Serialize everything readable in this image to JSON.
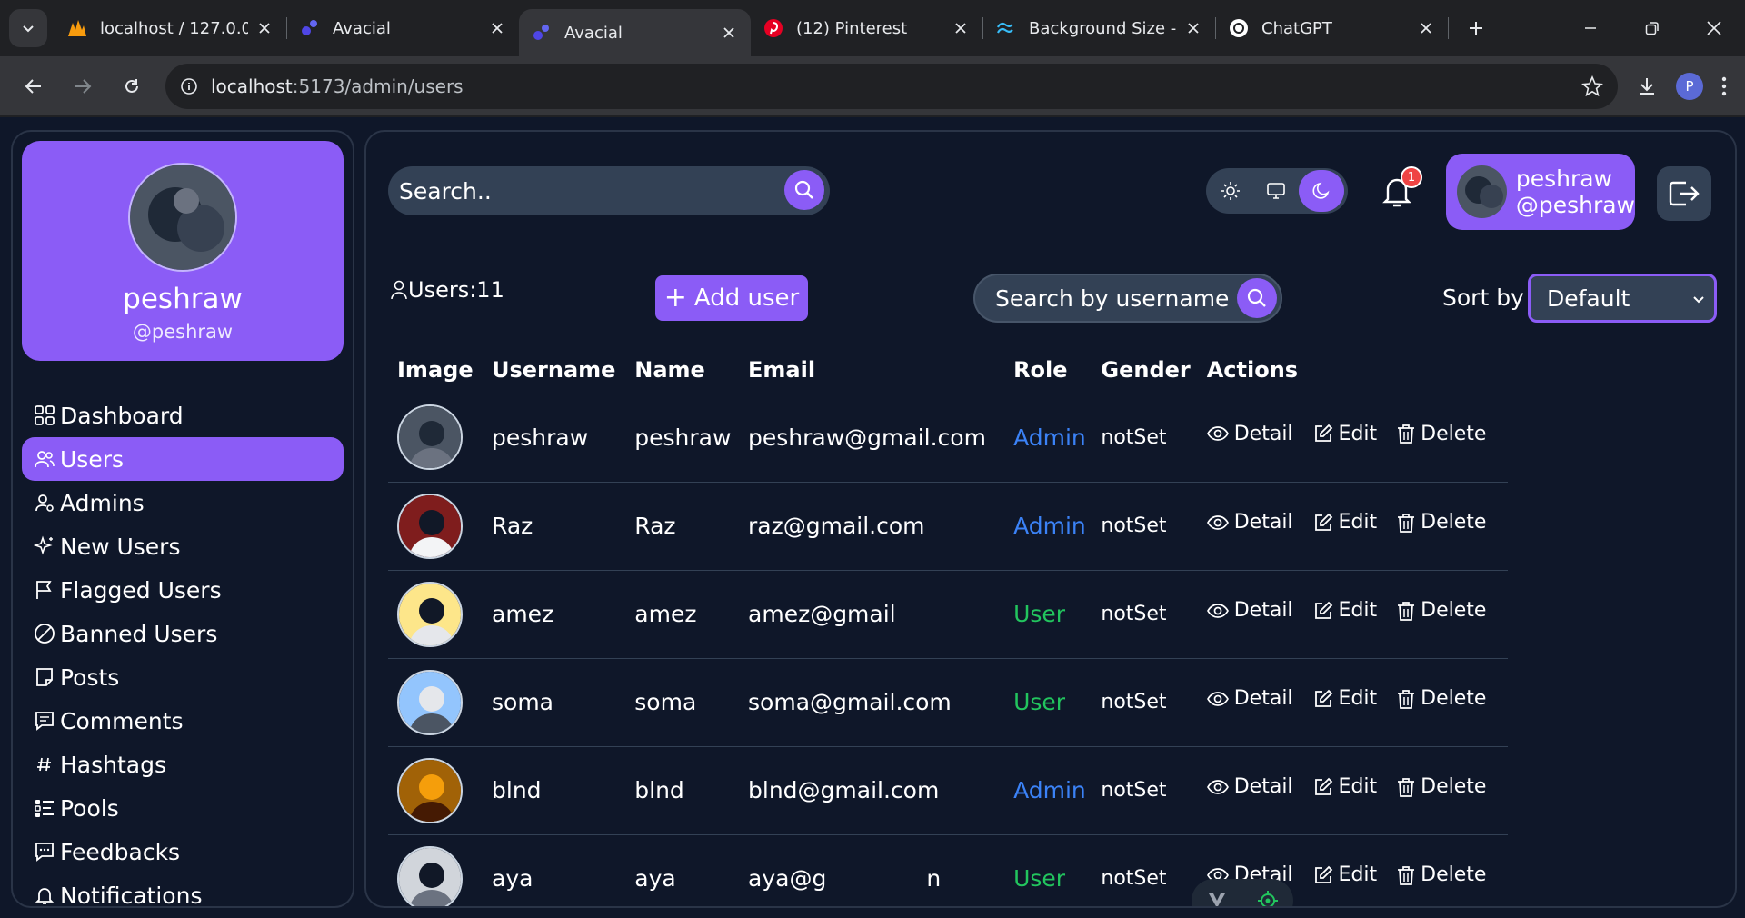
{
  "browser": {
    "tabs": [
      {
        "title": "localhost / 127.0.0",
        "icon": "phpmyadmin-icon"
      },
      {
        "title": "Avacial",
        "icon": "vite-app-icon"
      },
      {
        "title": "Avacial",
        "icon": "vite-app-icon",
        "active": true
      },
      {
        "title": "(12) Pinterest",
        "icon": "pinterest-icon"
      },
      {
        "title": "Background Size -",
        "icon": "tailwind-icon"
      },
      {
        "title": "ChatGPT",
        "icon": "chatgpt-icon"
      }
    ],
    "url_host": "localhost",
    "url_rest": ":5173/admin/users",
    "profile_initial": "P"
  },
  "sidebar": {
    "name": "peshraw",
    "username": "@peshraw",
    "items": [
      {
        "label": "Dashboard",
        "icon": "dashboard-icon"
      },
      {
        "label": "Users",
        "icon": "users-icon",
        "active": true
      },
      {
        "label": "Admins",
        "icon": "admins-icon"
      },
      {
        "label": "New Users",
        "icon": "sparkle-icon"
      },
      {
        "label": "Flagged Users",
        "icon": "flag-icon"
      },
      {
        "label": "Banned Users",
        "icon": "ban-icon"
      },
      {
        "label": "Posts",
        "icon": "post-icon"
      },
      {
        "label": "Comments",
        "icon": "comment-icon"
      },
      {
        "label": "Hashtags",
        "icon": "hashtag-icon"
      },
      {
        "label": "Pools",
        "icon": "poll-icon"
      },
      {
        "label": "Feedbacks",
        "icon": "feedback-icon"
      },
      {
        "label": "Notifications",
        "icon": "bell-icon"
      }
    ]
  },
  "header": {
    "search_placeholder": "Search..",
    "notification_count": "1",
    "user_name": "peshraw",
    "user_handle": "@peshraw"
  },
  "toolbar": {
    "users_count": "Users:11",
    "add_user_label": "Add user",
    "search_username_placeholder": "Search by username",
    "sort_label": "Sort by",
    "sort_value": "Default"
  },
  "table": {
    "columns": [
      "Image",
      "Username",
      "Name",
      "Email",
      "Role",
      "Gender",
      "Actions"
    ],
    "action_labels": {
      "detail": "Detail",
      "edit": "Edit",
      "delete": "Delete"
    },
    "rows": [
      {
        "username": "peshraw",
        "name": "peshraw",
        "email": "peshraw@gmail.com",
        "role": "Admin",
        "gender": "notSet"
      },
      {
        "username": "Raz",
        "name": "Raz",
        "email": "raz@gmail.com",
        "role": "Admin",
        "gender": "notSet"
      },
      {
        "username": "amez",
        "name": "amez",
        "email": "amez@gmail",
        "role": "User",
        "gender": "notSet"
      },
      {
        "username": "soma",
        "name": "soma",
        "email": "soma@gmail.com",
        "role": "User",
        "gender": "notSet"
      },
      {
        "username": "blnd",
        "name": "blnd",
        "email": "blnd@gmail.com",
        "role": "Admin",
        "gender": "notSet"
      },
      {
        "username": "aya",
        "name": "aya",
        "email": "aya@g",
        "email_tail": "n",
        "role": "User",
        "gender": "notSet"
      }
    ]
  },
  "colors": {
    "accent": "#8b5cf6",
    "admin": "#3b82f6",
    "user": "#22c55e",
    "bg": "#0f1729",
    "panel": "#334155"
  }
}
